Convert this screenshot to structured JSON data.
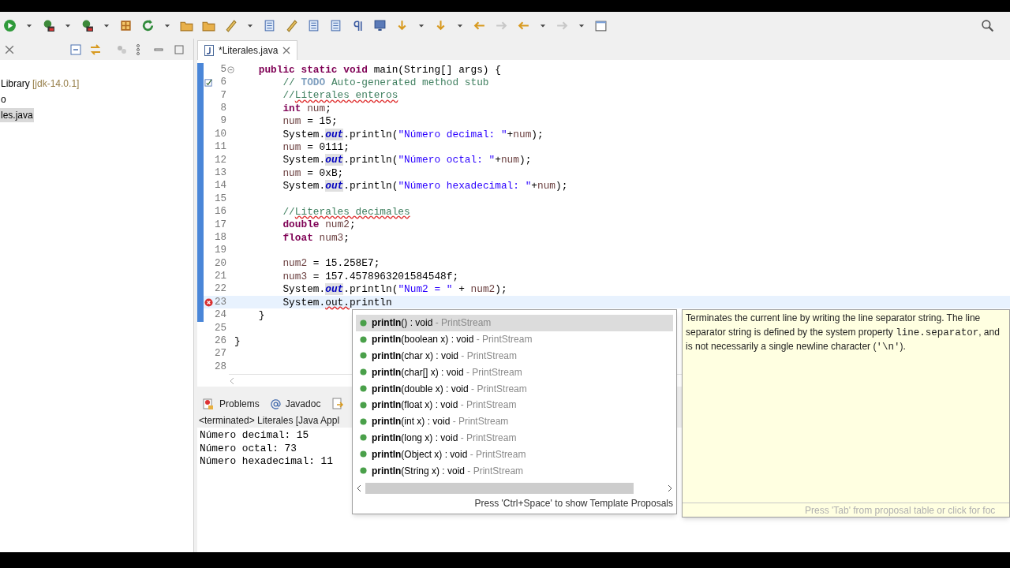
{
  "explorer": {
    "items": [
      {
        "segments": [
          {
            "text": "Library",
            "kind": "name"
          },
          {
            "text": " [jdk-14.0.1]",
            "kind": "decoration"
          }
        ],
        "selected": false
      },
      {
        "segments": [
          {
            "text": "o",
            "kind": "name"
          }
        ],
        "selected": false
      },
      {
        "segments": [
          {
            "text": "les.java",
            "kind": "name"
          }
        ],
        "selected": true
      }
    ]
  },
  "editor": {
    "tab": {
      "title": "*Literales.java"
    },
    "lines": [
      {
        "number": "5",
        "kind": "fold",
        "changed": true,
        "current": false,
        "segments": [
          {
            "text": "    public static void ",
            "kind": "keyword"
          },
          {
            "text": "main(String[] args) {",
            "kind": "plain"
          }
        ]
      },
      {
        "number": "6",
        "kind": "task",
        "changed": true,
        "current": false,
        "segments": [
          {
            "text": "        // ",
            "kind": "comment"
          },
          {
            "text": "TODO",
            "kind": "todo"
          },
          {
            "text": " Auto-generated method stub",
            "kind": "comment"
          }
        ]
      },
      {
        "number": "7",
        "kind": "plain",
        "changed": true,
        "current": false,
        "segments": [
          {
            "text": "        //",
            "kind": "comment"
          },
          {
            "text": "Literales enteros",
            "kind": "comment_spell"
          }
        ]
      },
      {
        "number": "8",
        "kind": "plain",
        "changed": true,
        "current": false,
        "segments": [
          {
            "text": "        int",
            "kind": "keyword"
          },
          {
            "text": " num",
            "kind": "variable"
          },
          {
            "text": ";",
            "kind": "plain"
          }
        ]
      },
      {
        "number": "9",
        "kind": "plain",
        "changed": true,
        "current": false,
        "segments": [
          {
            "text": "        num",
            "kind": "variable"
          },
          {
            "text": " = 15;",
            "kind": "plain"
          }
        ]
      },
      {
        "number": "10",
        "kind": "plain",
        "changed": true,
        "current": false,
        "segments": [
          {
            "text": "        System.",
            "kind": "plain"
          },
          {
            "text": "out",
            "kind": "field"
          },
          {
            "text": ".println(",
            "kind": "plain"
          },
          {
            "text": "\"Número decimal: \"",
            "kind": "string"
          },
          {
            "text": "+",
            "kind": "plain"
          },
          {
            "text": "num",
            "kind": "variable"
          },
          {
            "text": ");",
            "kind": "plain"
          }
        ]
      },
      {
        "number": "11",
        "kind": "plain",
        "changed": true,
        "current": false,
        "segments": [
          {
            "text": "        num",
            "kind": "variable"
          },
          {
            "text": " = 0111;",
            "kind": "plain"
          }
        ]
      },
      {
        "number": "12",
        "kind": "plain",
        "changed": true,
        "current": false,
        "segments": [
          {
            "text": "        System.",
            "kind": "plain"
          },
          {
            "text": "out",
            "kind": "field"
          },
          {
            "text": ".println(",
            "kind": "plain"
          },
          {
            "text": "\"Número octal: \"",
            "kind": "string"
          },
          {
            "text": "+",
            "kind": "plain"
          },
          {
            "text": "num",
            "kind": "variable"
          },
          {
            "text": ");",
            "kind": "plain"
          }
        ]
      },
      {
        "number": "13",
        "kind": "plain",
        "changed": true,
        "current": false,
        "segments": [
          {
            "text": "        num",
            "kind": "variable"
          },
          {
            "text": " = 0xB;",
            "kind": "plain"
          }
        ]
      },
      {
        "number": "14",
        "kind": "plain",
        "changed": true,
        "current": false,
        "segments": [
          {
            "text": "        System.",
            "kind": "plain"
          },
          {
            "text": "out",
            "kind": "field"
          },
          {
            "text": ".println(",
            "kind": "plain"
          },
          {
            "text": "\"Número hexadecimal: \"",
            "kind": "string"
          },
          {
            "text": "+",
            "kind": "plain"
          },
          {
            "text": "num",
            "kind": "variable"
          },
          {
            "text": ");",
            "kind": "plain"
          }
        ]
      },
      {
        "number": "15",
        "kind": "plain",
        "changed": true,
        "current": false
      },
      {
        "number": "16",
        "kind": "plain",
        "changed": true,
        "current": false,
        "segments": [
          {
            "text": "        //",
            "kind": "comment"
          },
          {
            "text": "Literales decimales",
            "kind": "comment_spell"
          }
        ]
      },
      {
        "number": "17",
        "kind": "plain",
        "changed": true,
        "current": false,
        "segments": [
          {
            "text": "        double",
            "kind": "keyword"
          },
          {
            "text": " num2",
            "kind": "variable"
          },
          {
            "text": ";",
            "kind": "plain"
          }
        ]
      },
      {
        "number": "18",
        "kind": "plain",
        "changed": true,
        "current": false,
        "segments": [
          {
            "text": "        float",
            "kind": "keyword"
          },
          {
            "text": " num3",
            "kind": "variable"
          },
          {
            "text": ";",
            "kind": "plain"
          }
        ]
      },
      {
        "number": "19",
        "kind": "plain",
        "changed": true,
        "current": false
      },
      {
        "number": "20",
        "kind": "plain",
        "changed": true,
        "current": false,
        "segments": [
          {
            "text": "        num2",
            "kind": "variable"
          },
          {
            "text": " = 15.258E7;",
            "kind": "plain"
          }
        ]
      },
      {
        "number": "21",
        "kind": "plain",
        "changed": true,
        "current": false,
        "segments": [
          {
            "text": "        num3",
            "kind": "variable"
          },
          {
            "text": " = 157.4578963201584548f;",
            "kind": "plain"
          }
        ]
      },
      {
        "number": "22",
        "kind": "plain",
        "changed": true,
        "current": false,
        "segments": [
          {
            "text": "        System.",
            "kind": "plain"
          },
          {
            "text": "out",
            "kind": "field"
          },
          {
            "text": ".println(",
            "kind": "plain"
          },
          {
            "text": "\"Num2 = \"",
            "kind": "string"
          },
          {
            "text": " + ",
            "kind": "plain"
          },
          {
            "text": "num2",
            "kind": "variable"
          },
          {
            "text": ");",
            "kind": "plain"
          }
        ]
      },
      {
        "number": "23",
        "kind": "error",
        "changed": true,
        "current": true,
        "segments": [
          {
            "text": "        System.",
            "kind": "plain"
          },
          {
            "text": "out.",
            "kind": "error"
          },
          {
            "text": "println",
            "kind": "plain"
          }
        ]
      },
      {
        "number": "24",
        "kind": "plain",
        "changed": true,
        "current": false,
        "segments": [
          {
            "text": "    }",
            "kind": "plain"
          }
        ]
      },
      {
        "number": "25",
        "kind": "plain",
        "changed": false,
        "current": false
      },
      {
        "number": "26",
        "kind": "plain",
        "changed": false,
        "current": false,
        "segments": [
          {
            "text": "}",
            "kind": "plain"
          }
        ]
      },
      {
        "number": "27",
        "kind": "plain",
        "changed": false,
        "current": false
      },
      {
        "number": "28",
        "kind": "plain",
        "changed": false,
        "current": false
      }
    ]
  },
  "bottom_panel": {
    "tabs": [
      {
        "label": "Problems",
        "kind": "problems"
      },
      {
        "label": "Javadoc",
        "kind": "javadoc"
      },
      {
        "kind": "declaration"
      }
    ],
    "console_title": "<terminated> Literales [Java Appl",
    "console_lines": [
      "Número decimal: 15",
      "Número octal: 73",
      "Número hexadecimal: 11"
    ]
  },
  "completion": {
    "proposals": [
      {
        "name": "println",
        "signature": "() : void",
        "owner": " - PrintStream",
        "selected": true
      },
      {
        "name": "println",
        "signature": "(boolean x) : void",
        "owner": " - PrintStream",
        "selected": false
      },
      {
        "name": "println",
        "signature": "(char x) : void",
        "owner": " - PrintStream",
        "selected": false
      },
      {
        "name": "println",
        "signature": "(char[] x) : void",
        "owner": " - PrintStream",
        "selected": false
      },
      {
        "name": "println",
        "signature": "(double x) : void",
        "owner": " - PrintStream",
        "selected": false
      },
      {
        "name": "println",
        "signature": "(float x) : void",
        "owner": " - PrintStream",
        "selected": false
      },
      {
        "name": "println",
        "signature": "(int x) : void",
        "owner": " - PrintStream",
        "selected": false
      },
      {
        "name": "println",
        "signature": "(long x) : void",
        "owner": " - PrintStream",
        "selected": false
      },
      {
        "name": "println",
        "signature": "(Object x) : void",
        "owner": " - PrintStream",
        "selected": false
      },
      {
        "name": "println",
        "signature": "(String x) : void",
        "owner": " - PrintStream",
        "selected": false
      }
    ],
    "footer": "Press 'Ctrl+Space' to show Template Proposals"
  },
  "javadoc_popup": {
    "segments": [
      {
        "text": "Terminates the current line by writing the line separator string. The line separator string is defined by the system property ",
        "kind": "text"
      },
      {
        "text": "line.separator",
        "kind": "code"
      },
      {
        "text": ", and is not necessarily a single newline character (",
        "kind": "text"
      },
      {
        "text": "'\\n'",
        "kind": "code"
      },
      {
        "text": ").",
        "kind": "text"
      }
    ],
    "footer": "Press 'Tab' from proposal table or click for foc"
  }
}
